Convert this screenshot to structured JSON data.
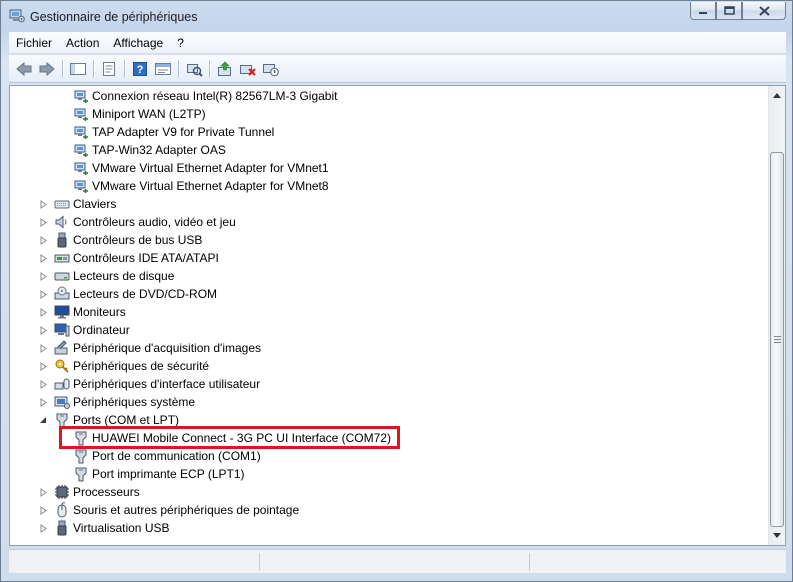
{
  "window": {
    "title": "Gestionnaire de périphériques"
  },
  "menu": [
    "Fichier",
    "Action",
    "Affichage",
    "?"
  ],
  "tree": [
    {
      "label": "Connexion réseau Intel(R) 82567LM-3 Gigabit",
      "level": 2,
      "icon": "network-adapter-icon"
    },
    {
      "label": "Miniport WAN (L2TP)",
      "level": 2,
      "icon": "network-adapter-icon"
    },
    {
      "label": "TAP Adapter V9 for Private Tunnel",
      "level": 2,
      "icon": "network-adapter-icon"
    },
    {
      "label": "TAP-Win32 Adapter OAS",
      "level": 2,
      "icon": "network-adapter-icon"
    },
    {
      "label": "VMware Virtual Ethernet Adapter for VMnet1",
      "level": 2,
      "icon": "network-adapter-icon"
    },
    {
      "label": "VMware Virtual Ethernet Adapter for VMnet8",
      "level": 2,
      "icon": "network-adapter-icon"
    },
    {
      "label": "Claviers",
      "level": 1,
      "icon": "keyboard-icon",
      "expander": "collapsed"
    },
    {
      "label": "Contrôleurs audio, vidéo et jeu",
      "level": 1,
      "icon": "speaker-icon",
      "expander": "collapsed"
    },
    {
      "label": "Contrôleurs de bus USB",
      "level": 1,
      "icon": "usb-icon",
      "expander": "collapsed"
    },
    {
      "label": "Contrôleurs IDE ATA/ATAPI",
      "level": 1,
      "icon": "ide-controller-icon",
      "expander": "collapsed"
    },
    {
      "label": "Lecteurs de disque",
      "level": 1,
      "icon": "disk-drive-icon",
      "expander": "collapsed"
    },
    {
      "label": "Lecteurs de DVD/CD-ROM",
      "level": 1,
      "icon": "dvd-drive-icon",
      "expander": "collapsed"
    },
    {
      "label": "Moniteurs",
      "level": 1,
      "icon": "monitor-icon",
      "expander": "collapsed"
    },
    {
      "label": "Ordinateur",
      "level": 1,
      "icon": "computer-icon",
      "expander": "collapsed"
    },
    {
      "label": "Périphérique d'acquisition d'images",
      "level": 1,
      "icon": "camera-icon",
      "expander": "collapsed"
    },
    {
      "label": "Périphériques de sécurité",
      "level": 1,
      "icon": "security-key-icon",
      "expander": "collapsed"
    },
    {
      "label": "Périphériques d'interface utilisateur",
      "level": 1,
      "icon": "hid-icon",
      "expander": "collapsed"
    },
    {
      "label": "Périphériques système",
      "level": 1,
      "icon": "system-device-icon",
      "expander": "collapsed"
    },
    {
      "label": "Ports (COM et LPT)",
      "level": 1,
      "icon": "port-icon",
      "expander": "expanded"
    },
    {
      "label": "HUAWEI Mobile Connect - 3G PC UI Interface (COM72)",
      "level": 2,
      "icon": "port-icon"
    },
    {
      "label": "Port de communication (COM1)",
      "level": 2,
      "icon": "port-icon"
    },
    {
      "label": "Port imprimante ECP (LPT1)",
      "level": 2,
      "icon": "port-icon"
    },
    {
      "label": "Processeurs",
      "level": 1,
      "icon": "processor-icon",
      "expander": "collapsed"
    },
    {
      "label": "Souris et autres périphériques de pointage",
      "level": 1,
      "icon": "mouse-icon",
      "expander": "collapsed"
    },
    {
      "label": "Virtualisation USB",
      "level": 1,
      "icon": "usb-icon",
      "expander": "collapsed"
    }
  ],
  "colors": {
    "highlight": "#e0141b",
    "chrome": "#c8d8ec"
  }
}
